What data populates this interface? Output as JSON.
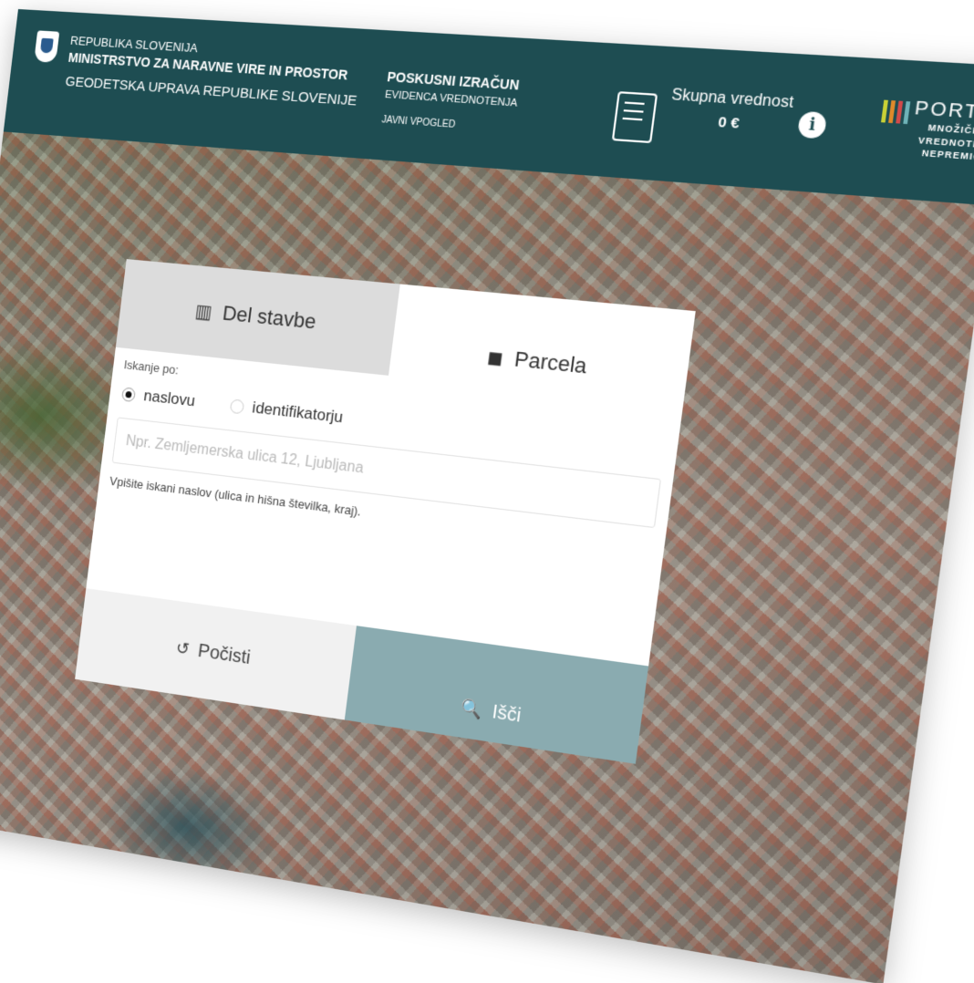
{
  "header": {
    "org_line1": "REPUBLIKA SLOVENIJA",
    "org_line2": "MINISTRSTVO ZA NARAVNE VIRE IN PROSTOR",
    "org_line3": "GEODETSKA UPRAVA REPUBLIKE SLOVENIJE",
    "app_title": "POSKUSNI IZRAČUN",
    "app_subtitle": "EVIDENCA VREDNOTENJA",
    "app_mode": "JAVNI VPOGLED",
    "total_label": "Skupna vrednost",
    "total_value": "0 €",
    "info_icon_glyph": "i",
    "portal_title": "PORTAL",
    "portal_line1": "MNOŽIČNEGA",
    "portal_line2": "VREDNOTENJA",
    "portal_line3": "NEPREMIČNIN",
    "portal_bar_colors": [
      "#c9d136",
      "#e08a2a",
      "#d24a4a",
      "#6fb3b8"
    ]
  },
  "tabs": {
    "building_part": {
      "label": "Del stavbe",
      "icon": "building-icon",
      "glyph": "▥"
    },
    "parcel": {
      "label": "Parcela",
      "icon": "parcel-icon",
      "glyph": "◼"
    }
  },
  "search": {
    "search_by_label": "Iskanje po:",
    "option_address": "naslovu",
    "option_identifier": "identifikatorju",
    "selected": "naslovu",
    "address_placeholder": "Npr. Zemljemerska ulica 12, Ljubljana",
    "address_value": "",
    "hint": "Vpišite iskani naslov (ulica in hišna številka, kraj)."
  },
  "actions": {
    "clear_label": "Počisti",
    "clear_glyph": "↺",
    "search_label": "Išči",
    "search_glyph": "🔍"
  },
  "colors": {
    "header_bg": "#1e4d52",
    "search_button_bg": "#8aabb0"
  }
}
